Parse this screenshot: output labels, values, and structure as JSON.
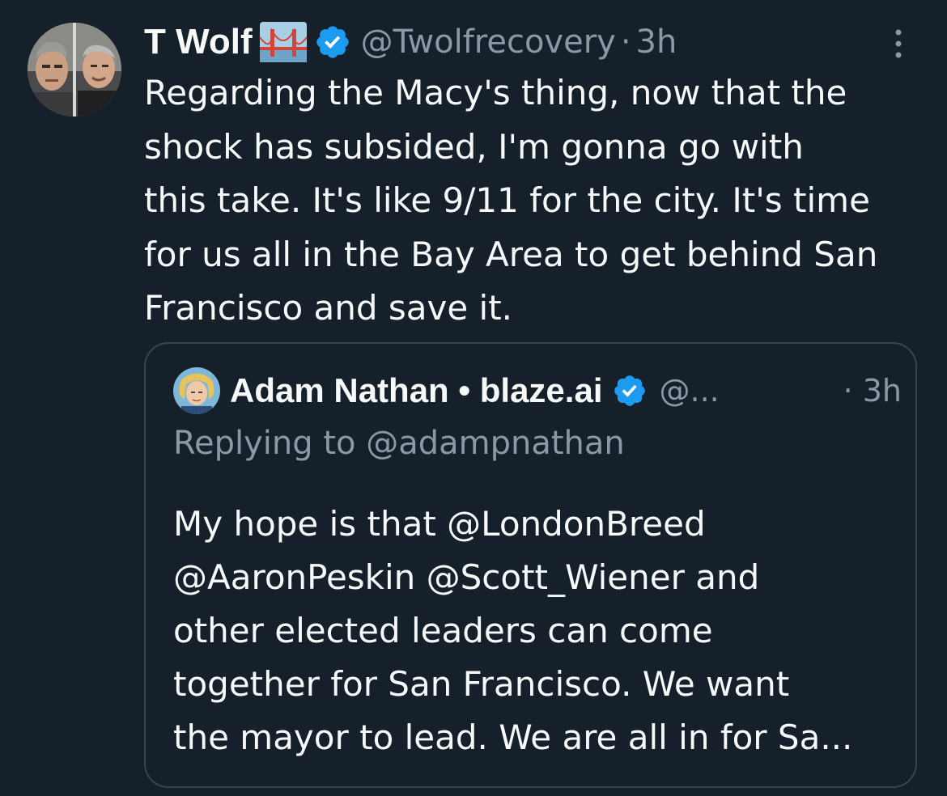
{
  "tweet": {
    "author": {
      "name": "T Wolf",
      "handle": "@Twolfrecovery",
      "separator": "·",
      "time": "3h",
      "flag_icon": "golden-gate-bridge-icon",
      "verified": true
    },
    "text": "Regarding the Macy's thing, now that the\nshock has subsided, I'm gonna go with\nthis take. It's like 9/11 for the city. It's time\nfor us all in the Bay Area to get behind San\nFrancisco and save it."
  },
  "quoted_tweet": {
    "author": {
      "name": "Adam Nathan • blaze.ai",
      "handle": "@...",
      "time": "· 3h",
      "verified": true
    },
    "replying_to": "Replying to @adampnathan",
    "text": "My hope is that @LondonBreed\n@AaronPeskin @Scott_Wiener and\nother elected leaders can come\ntogether for San Francisco. We want\nthe mayor to lead. We are all in for Sa..."
  },
  "colors": {
    "background": "#15202b",
    "text_primary": "#f7f9f9",
    "text_secondary": "#8b98a5",
    "verified_blue": "#1d9bf0",
    "border": "#38444d"
  }
}
